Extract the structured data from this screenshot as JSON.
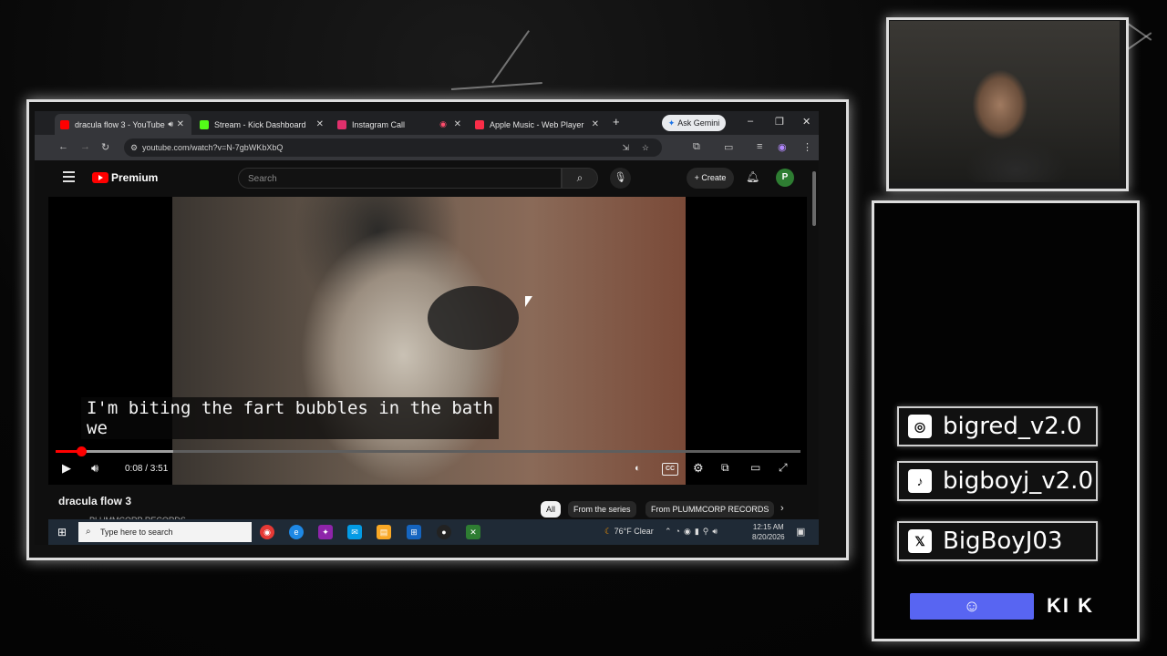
{
  "browser": {
    "tabs": [
      {
        "label": "dracula flow 3 - YouTube",
        "favicon_color": "#ff0000",
        "active": true
      },
      {
        "label": "Stream - Kick Dashboard",
        "favicon_color": "#53fc18",
        "active": false
      },
      {
        "label": "Instagram Call",
        "favicon_color": "#e1306c",
        "active": false
      },
      {
        "label": "Apple Music - Web Player",
        "favicon_color": "#fa2d48",
        "active": false
      }
    ],
    "new_tab": "+",
    "gemini_label": "Ask Gemini",
    "url": "youtube.com/watch?v=N-7gbWKbXbQ"
  },
  "youtube": {
    "logo_text": "Premium",
    "search_placeholder": "Search",
    "create_label": "Create",
    "avatar_letter": "P",
    "caption_line1": "I'm biting the fart bubbles in the bath",
    "caption_line2": "we",
    "time": "0:08 / 3:51",
    "progress_fraction": 0.034,
    "buffered_fraction": 0.158,
    "title": "dracula flow 3",
    "channel_partial": "PLUMMCORP RECORDS",
    "chips": [
      {
        "label": "All",
        "active": true
      },
      {
        "label": "From the series",
        "active": false
      },
      {
        "label": "From PLUMMCORP RECORDS",
        "active": false
      }
    ]
  },
  "taskbar": {
    "search_placeholder": "Type here to search",
    "weather": "76°F  Clear",
    "time": "12:15 AM",
    "date": "8/20/2026"
  },
  "overlay": {
    "instagram": "bigred_v2.0",
    "tiktok": "bigboyj_v2.0",
    "x": "BigBoyJ03",
    "kick": "KI K"
  },
  "colors": {
    "accent_red": "#ff0000",
    "discord": "#5865f2"
  },
  "icons": [
    "instagram-icon",
    "tiktok-icon",
    "x-icon",
    "discord-icon",
    "kick-icon"
  ]
}
